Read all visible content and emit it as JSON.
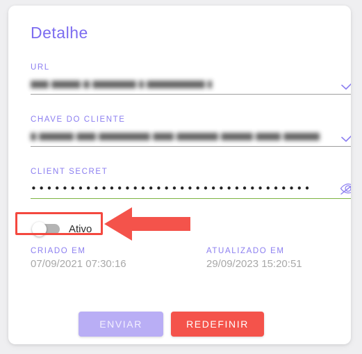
{
  "card": {
    "title": "Detalhe"
  },
  "fields": [
    {
      "label": "URL",
      "value": "",
      "redacted": true,
      "status_icon": "check-icon",
      "underline": "default"
    },
    {
      "label": "CHAVE DO CLIENTE",
      "value": "",
      "redacted": true,
      "status_icon": "check-icon",
      "underline": "default"
    },
    {
      "label": "CLIENT SECRET",
      "value": "••••••••••••••••••••••••••••••••••••••••••••••••••",
      "redacted": false,
      "status_icon": "eye-off-icon",
      "underline": "valid"
    }
  ],
  "toggle": {
    "label": "Ativo",
    "state": "off"
  },
  "meta": {
    "created": {
      "label": "CRIADO EM",
      "value": "07/09/2021 07:30:16"
    },
    "updated": {
      "label": "ATUALIZADO EM",
      "value": "29/09/2023 15:20:51"
    }
  },
  "actions": {
    "submit_label": "ENVIAR",
    "reset_label": "REDEFINIR"
  },
  "colors": {
    "accent_purple": "#7c6cf0",
    "label_purple": "#8b7ef0",
    "valid_green": "#7cb342",
    "danger_red": "#f4534b",
    "annotation_red": "#f4483f",
    "submit_disabled": "#b9aef5",
    "page_background": "#efeff1",
    "card_background": "#ffffff"
  }
}
